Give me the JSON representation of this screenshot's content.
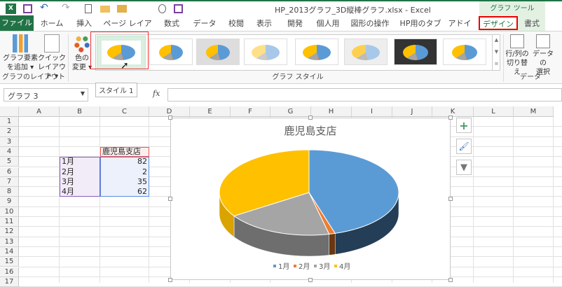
{
  "title": "HP_2013グラフ_3D縦棒グラフ.xlsx - Excel",
  "context_tab": "グラフ ツール",
  "tabs": [
    "ファイル",
    "ホーム",
    "挿入",
    "ページ レイアウト",
    "数式",
    "データ",
    "校閲",
    "表示",
    "開発",
    "個人用",
    "図形の操作",
    "HP用のタブ",
    "アドイン",
    "デザイン",
    "書式"
  ],
  "ribbon": {
    "add_element": [
      "グラフ要素",
      "を追加 ▾"
    ],
    "quick_layout": [
      "クイック",
      "レイアウト ▾"
    ],
    "layout_group": "グラフのレイアウト",
    "change_color": [
      "色の",
      "変更 ▾"
    ],
    "style_group": "グラフ スタイル",
    "switch_rowcol": [
      "行/列の",
      "切り替え"
    ],
    "select_data": [
      "データの",
      "選択"
    ],
    "data_group": "データ",
    "tooltip": "スタイル 1"
  },
  "name_box": "グラフ 3",
  "fx": "fx",
  "columns": [
    "A",
    "B",
    "C",
    "D",
    "E",
    "F",
    "G",
    "H",
    "I",
    "J",
    "K",
    "L",
    "M"
  ],
  "rows": [
    "1",
    "2",
    "3",
    "4",
    "5",
    "6",
    "7",
    "8",
    "9",
    "10",
    "11",
    "12",
    "13",
    "14",
    "15",
    "16",
    "17"
  ],
  "table": {
    "header": "鹿児島支店",
    "labels": [
      "1月",
      "2月",
      "3月",
      "4月"
    ],
    "values": [
      "82",
      "2",
      "35",
      "62"
    ]
  },
  "chart_data": {
    "type": "pie",
    "title": "鹿児島支店",
    "categories": [
      "1月",
      "2月",
      "3月",
      "4月"
    ],
    "values": [
      82,
      2,
      35,
      62
    ],
    "colors": [
      "#5b9bd5",
      "#ed7d31",
      "#a5a5a5",
      "#ffc000"
    ],
    "side_colors": [
      "#243e57",
      "#6b3612",
      "#6e6e6e",
      "#d9a300"
    ],
    "legend": "bottom"
  }
}
